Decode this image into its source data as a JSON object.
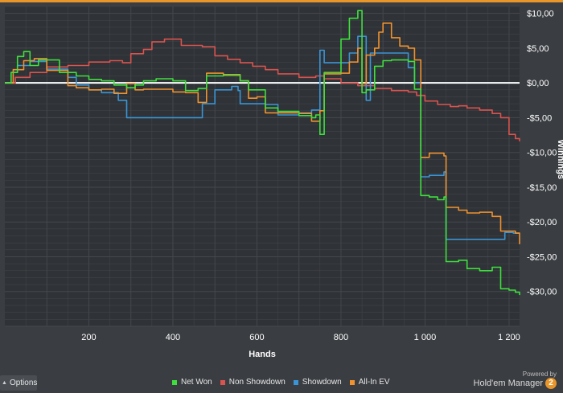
{
  "chart_data": {
    "type": "line",
    "xlabel": "Hands",
    "ylabel": "Winnings",
    "xlim": [
      0,
      1225
    ],
    "ylim": [
      -35,
      11
    ],
    "xticks": [
      200,
      400,
      600,
      800,
      1000,
      1200
    ],
    "xtick_labels": [
      "200",
      "400",
      "600",
      "800",
      "1 000",
      "1 200"
    ],
    "yticks": [
      10,
      5,
      0,
      -5,
      -10,
      -15,
      -20,
      -25,
      -30
    ],
    "ytick_labels": [
      "$10,00",
      "$5,00",
      "$0,00",
      "-$5,00",
      "-$10,00",
      "-$15,00",
      "-$20,00",
      "-$25,00",
      "-$30,00"
    ],
    "grid": true,
    "legend_position": "bottom",
    "series": [
      {
        "name": "Non Showdown",
        "color": "#d9534f",
        "x": [
          0,
          25,
          60,
          100,
          150,
          200,
          250,
          280,
          300,
          330,
          350,
          380,
          420,
          470,
          500,
          530,
          560,
          590,
          620,
          650,
          700,
          740,
          760,
          800,
          840,
          880,
          920,
          960,
          980,
          1000,
          1030,
          1060,
          1080,
          1100,
          1130,
          1160,
          1180,
          1200,
          1215,
          1225
        ],
        "y": [
          0,
          0.8,
          1.5,
          2.3,
          2.5,
          3.0,
          3.2,
          2.9,
          4.2,
          4.8,
          5.9,
          6.3,
          5.4,
          5.2,
          3.9,
          3.4,
          2.9,
          2.4,
          1.9,
          1.3,
          0.8,
          1.0,
          0.6,
          0.0,
          -0.4,
          -0.8,
          -1.1,
          -1.3,
          -1.8,
          -2.6,
          -3.1,
          -3.4,
          -3.3,
          -3.6,
          -3.9,
          -4.4,
          -5.0,
          -7.4,
          -8.0,
          -8.4
        ]
      },
      {
        "name": "Showdown",
        "color": "#3a95d6",
        "x": [
          0,
          15,
          30,
          60,
          100,
          150,
          170,
          200,
          230,
          270,
          290,
          330,
          380,
          440,
          470,
          500,
          540,
          555,
          560,
          600,
          620,
          650,
          700,
          730,
          750,
          760,
          790,
          820,
          840,
          860,
          870,
          880,
          900,
          940,
          960,
          975,
          990,
          1010,
          1030,
          1045,
          1050,
          1080,
          1110,
          1130,
          1160,
          1175,
          1190,
          1210,
          1225
        ],
        "y": [
          0,
          1.5,
          2.5,
          3.1,
          2.0,
          0.8,
          -0.3,
          -1.0,
          -1.4,
          -2.5,
          -5.0,
          -5.0,
          -5.0,
          -5.0,
          -3.0,
          -1.0,
          -0.5,
          -1.1,
          -3.0,
          -3.0,
          -3.1,
          -4.6,
          -4.3,
          -3.9,
          4.7,
          2.9,
          2.9,
          4.3,
          6.7,
          -2.5,
          4.3,
          4.3,
          4.3,
          4.3,
          2.2,
          0.0,
          -13.5,
          -13.3,
          -13.3,
          -12.8,
          -22.5,
          -22.5,
          -22.5,
          -22.5,
          -22.5,
          -22.5,
          -21.5,
          -21.6,
          -21.6
        ]
      },
      {
        "name": "All-In EV",
        "color": "#f0922e",
        "x": [
          0,
          20,
          45,
          70,
          100,
          150,
          170,
          200,
          230,
          260,
          290,
          310,
          330,
          360,
          400,
          430,
          460,
          480,
          520,
          560,
          580,
          600,
          620,
          650,
          700,
          730,
          740,
          750,
          760,
          780,
          800,
          820,
          840,
          850,
          860,
          870,
          880,
          890,
          900,
          920,
          940,
          960,
          975,
          990,
          1010,
          1030,
          1045,
          1050,
          1065,
          1080,
          1100,
          1130,
          1160,
          1180,
          1200,
          1215,
          1225
        ],
        "y": [
          0,
          1.9,
          3.2,
          3.5,
          1.8,
          -0.4,
          -0.7,
          -1.0,
          -0.9,
          -1.5,
          -0.1,
          -1.0,
          -0.9,
          -0.9,
          -1.3,
          -1.4,
          -2.8,
          1.4,
          1.2,
          0.3,
          -2.2,
          -2.0,
          -4.3,
          -4.3,
          -4.4,
          -5.5,
          -5.5,
          -4.0,
          1.3,
          1.3,
          1.4,
          3.0,
          5.0,
          -0.1,
          4.0,
          4.0,
          5.0,
          7.3,
          8.6,
          6.5,
          5.3,
          5.0,
          3.3,
          -10.7,
          -10.1,
          -10.1,
          -10.5,
          -17.9,
          -17.9,
          -18.3,
          -18.7,
          -18.6,
          -19.2,
          -21.3,
          -21.3,
          -21.6,
          -23.2
        ]
      },
      {
        "name": "Net Won",
        "color": "#3ee03e",
        "x": [
          0,
          15,
          30,
          45,
          60,
          80,
          100,
          130,
          150,
          170,
          200,
          230,
          260,
          290,
          310,
          330,
          360,
          400,
          430,
          460,
          480,
          520,
          560,
          580,
          600,
          620,
          650,
          700,
          730,
          740,
          750,
          760,
          780,
          800,
          820,
          840,
          850,
          860,
          880,
          900,
          920,
          940,
          960,
          975,
          990,
          1010,
          1030,
          1045,
          1050,
          1060,
          1080,
          1100,
          1130,
          1160,
          1180,
          1200,
          1215,
          1225
        ],
        "y": [
          0,
          1.5,
          3.8,
          4.5,
          2.5,
          3.3,
          3.3,
          1.5,
          1.5,
          1.0,
          0.5,
          0.3,
          -0.3,
          -0.7,
          -0.3,
          0.3,
          0.6,
          0.3,
          -1.1,
          -0.8,
          1.0,
          1.1,
          0.3,
          -1.0,
          -1.0,
          -3.6,
          -4.1,
          -4.7,
          -5.0,
          -4.6,
          -7.4,
          1.5,
          1.5,
          6.3,
          9.3,
          10.4,
          -1.4,
          -1.0,
          2.4,
          3.2,
          3.3,
          3.3,
          3.1,
          -0.9,
          -16.2,
          -16.4,
          -16.8,
          -16.4,
          -25.7,
          -25.7,
          -25.5,
          -26.7,
          -27.0,
          -26.5,
          -29.6,
          -29.8,
          -30.1,
          -30.5
        ]
      }
    ]
  },
  "legend": [
    {
      "label": "Net Won",
      "color": "#3ee03e"
    },
    {
      "label": "Non Showdown",
      "color": "#d9534f"
    },
    {
      "label": "Showdown",
      "color": "#3a95d6"
    },
    {
      "label": "All-In EV",
      "color": "#f0922e"
    }
  ],
  "options_label": "Options",
  "options_icon": "chevron-up-icon",
  "brand": {
    "powered_by": "Powered by",
    "name": "Hold'em Manager",
    "badge": "2"
  },
  "colors": {
    "background": "#3a3d41",
    "plot_area": "#2f3236",
    "grid": "#44484d",
    "zero_line": "#ffffff",
    "accent": "#e8952a"
  }
}
